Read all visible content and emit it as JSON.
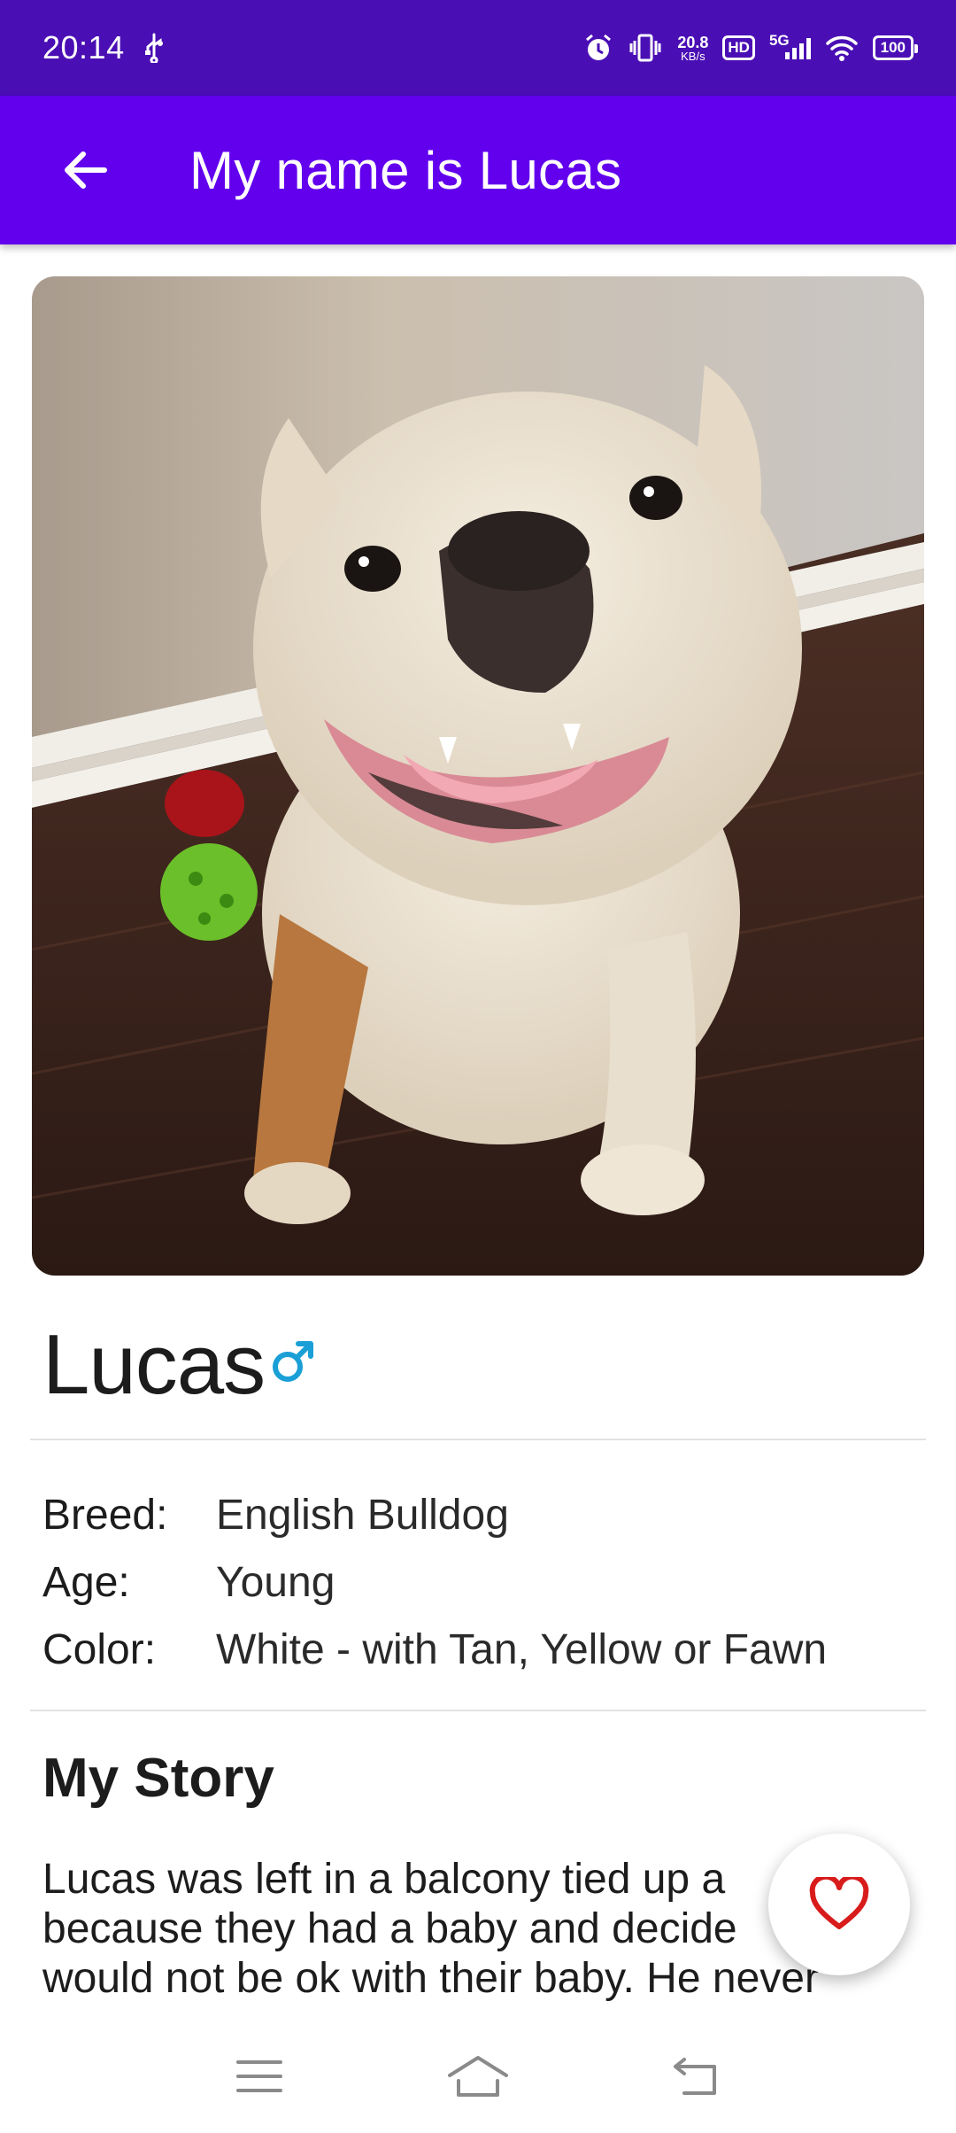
{
  "status_bar": {
    "time": "20:14",
    "usb_icon": "usb-icon",
    "net_speed_value": "20.8",
    "net_speed_unit": "KB/s",
    "hd_label": "HD",
    "network_label": "5G",
    "battery_level": "100",
    "icons": [
      "alarm-icon",
      "vibrate-icon",
      "hd-icon",
      "signal-icon",
      "wifi-icon",
      "battery-icon"
    ]
  },
  "app_bar": {
    "title": "My name is Lucas",
    "back_icon": "arrow-left-icon",
    "background": "#6200ee",
    "status_background": "#4a0fb4"
  },
  "pet": {
    "name": "Lucas",
    "gender_icon": "male-icon",
    "gender_color": "#1a9fd6",
    "details": [
      {
        "label": "Breed:",
        "value": "English Bulldog"
      },
      {
        "label": "Age:",
        "value": "Young"
      },
      {
        "label": "Color:",
        "value": "White - with Tan, Yellow or Fawn"
      }
    ],
    "story_heading": "My Story",
    "story_lines": [
      "Lucas was left in a balcony tied up a",
      "because they had a baby and decide",
      "would not be ok with their baby. He never"
    ]
  },
  "fab": {
    "icon": "heart-outline-icon",
    "color": "#d81b1b"
  },
  "nav_bar": {
    "icons": [
      "menu-icon",
      "home-icon",
      "back-icon"
    ]
  }
}
